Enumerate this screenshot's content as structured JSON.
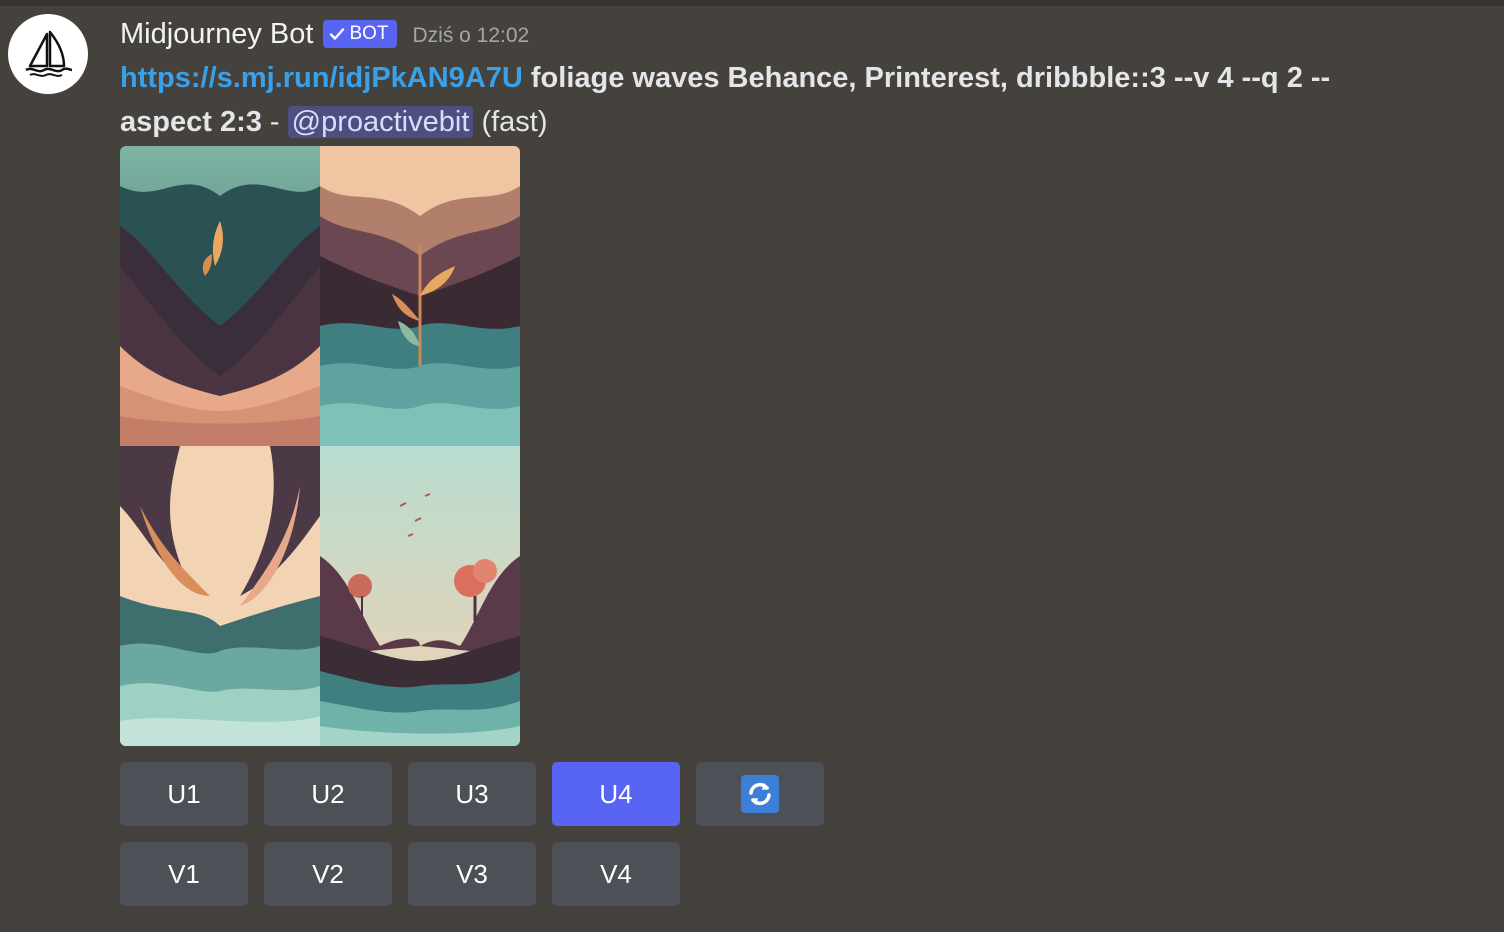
{
  "message": {
    "author": "Midjourney Bot",
    "bot_tag": "BOT",
    "bot_tag_icon": "checkmark-icon",
    "timestamp": "Dziś o 12:02",
    "link": "https://s.mj.run/idjPkAN9A7U",
    "prompt": "foliage waves Behance, Printerest, dribbble::3 --v 4 --q 2 --aspect 2:3",
    "separator": " - ",
    "mention": "@proactivebit",
    "speed": "(fast)",
    "avatar_icon": "sailboat-logo-icon"
  },
  "image_grid": {
    "icon": "generated-image-grid",
    "tiles": [
      "foliage-wave-image-1",
      "foliage-wave-image-2",
      "foliage-wave-image-3",
      "foliage-wave-image-4"
    ]
  },
  "buttons": {
    "upscale": [
      "U1",
      "U2",
      "U3",
      "U4"
    ],
    "variation": [
      "V1",
      "V2",
      "V3",
      "V4"
    ],
    "active": "U4",
    "reroll_icon": "refresh-icon"
  },
  "colors": {
    "background": "#45413c",
    "button": "#4d5157",
    "button_active": "#5865f2",
    "link": "#3aa0e8",
    "mention_bg": "#4e4f80"
  }
}
